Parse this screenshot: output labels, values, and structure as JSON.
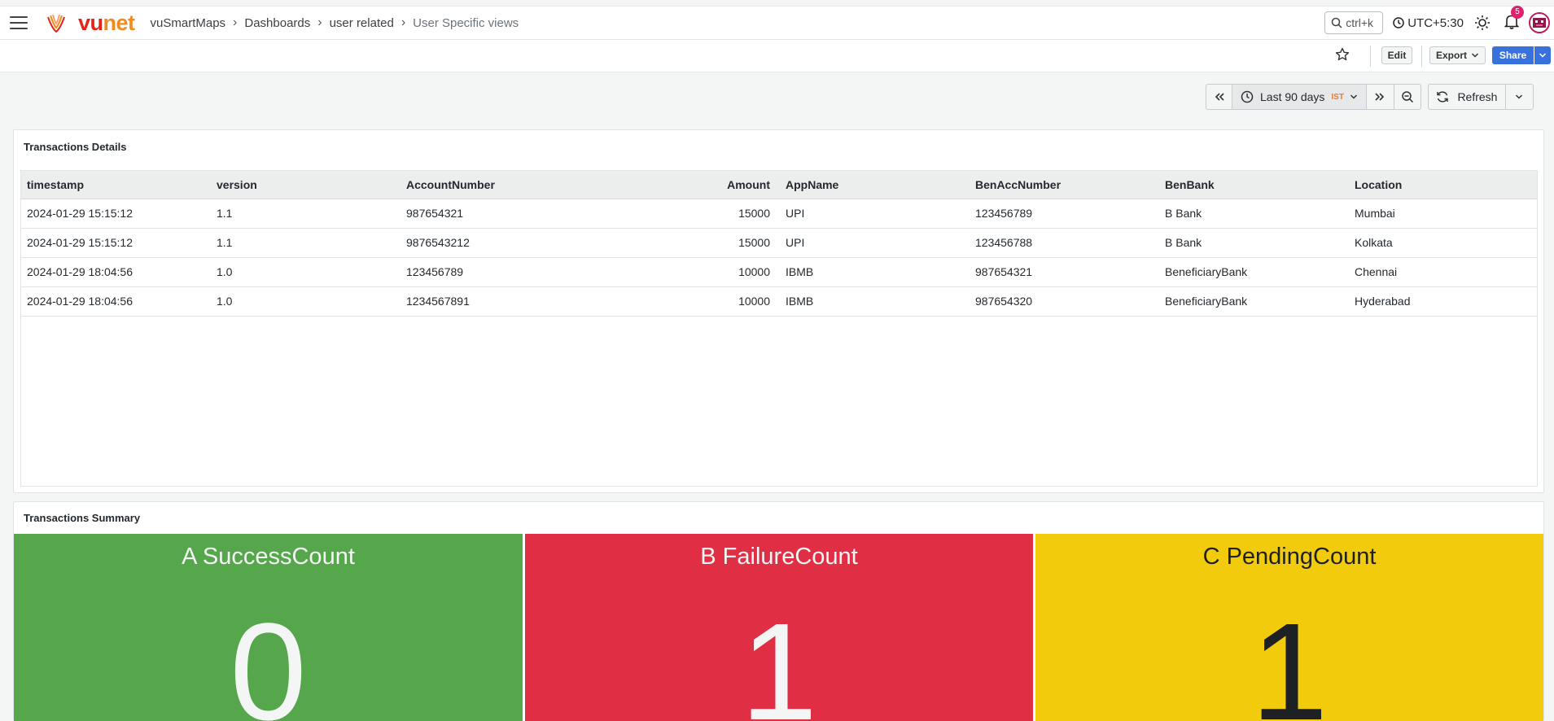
{
  "app": {
    "logo_vu": "vu",
    "logo_net": "net"
  },
  "breadcrumb": {
    "items": [
      "vuSmartMaps",
      "Dashboards",
      "user related"
    ],
    "current": "User Specific views"
  },
  "header": {
    "search_placeholder": "ctrl+k",
    "timezone": "UTC+5:30",
    "notification_count": "5"
  },
  "toolbar": {
    "edit_label": "Edit",
    "export_label": "Export",
    "share_label": "Share"
  },
  "time_picker": {
    "range": "Last 90 days",
    "tz_badge": "IST",
    "refresh_label": "Refresh"
  },
  "details_panel": {
    "title": "Transactions Details",
    "columns": [
      "timestamp",
      "version",
      "AccountNumber",
      "Amount",
      "AppName",
      "BenAccNumber",
      "BenBank",
      "Location"
    ],
    "rows": [
      [
        "2024-01-29 15:15:12",
        "1.1",
        "987654321",
        "15000",
        "UPI",
        "123456789",
        "B Bank",
        "Mumbai"
      ],
      [
        "2024-01-29 15:15:12",
        "1.1",
        "9876543212",
        "15000",
        "UPI",
        "123456788",
        "B Bank",
        "Kolkata"
      ],
      [
        "2024-01-29 18:04:56",
        "1.0",
        "123456789",
        "10000",
        "IBMB",
        "987654321",
        "BeneficiaryBank",
        "Chennai"
      ],
      [
        "2024-01-29 18:04:56",
        "1.0",
        "1234567891",
        "10000",
        "IBMB",
        "987654320",
        "BeneficiaryBank",
        "Hyderabad"
      ]
    ]
  },
  "summary_panel": {
    "title": "Transactions Summary",
    "stats": [
      {
        "title": "A SuccessCount",
        "value": "0",
        "bg": "#56a64b",
        "fg": "#f4f5f5"
      },
      {
        "title": "B FailureCount",
        "value": "1",
        "bg": "#e02f44",
        "fg": "#f4f5f5"
      },
      {
        "title": "C PendingCount",
        "value": "1",
        "bg": "#f2cc0c",
        "fg": "#1e2124"
      }
    ]
  }
}
